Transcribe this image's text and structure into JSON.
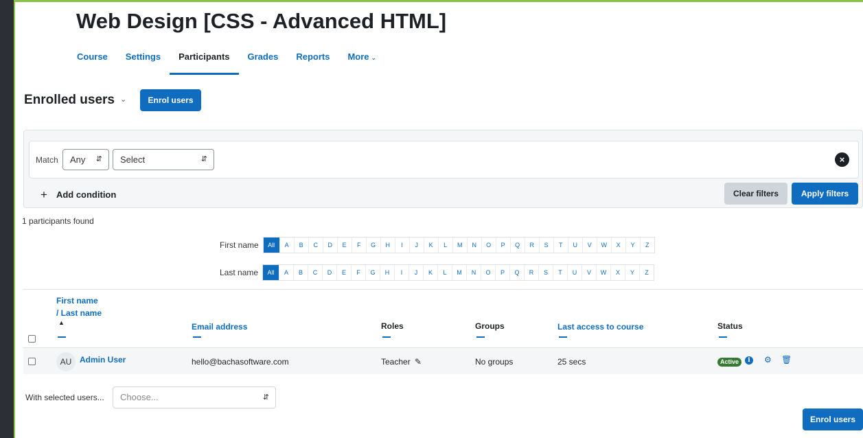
{
  "course": {
    "title": "Web Design [CSS - Advanced HTML]"
  },
  "nav": {
    "items": [
      {
        "label": "Course"
      },
      {
        "label": "Settings"
      },
      {
        "label": "Participants"
      },
      {
        "label": "Grades"
      },
      {
        "label": "Reports"
      },
      {
        "label": "More"
      }
    ],
    "active": "Participants"
  },
  "enrolled": {
    "heading": "Enrolled users",
    "enrol_button": "Enrol users"
  },
  "filters": {
    "match_label": "Match",
    "match_value": "Any",
    "field_value": "Select",
    "add_condition": "Add condition",
    "clear_button": "Clear filters",
    "apply_button": "Apply filters"
  },
  "results": {
    "found_text": "1 participants found"
  },
  "initials": {
    "first_label": "First name",
    "last_label": "Last name",
    "all_label": "All",
    "letters": [
      "A",
      "B",
      "C",
      "D",
      "E",
      "F",
      "G",
      "H",
      "I",
      "J",
      "K",
      "L",
      "M",
      "N",
      "O",
      "P",
      "Q",
      "R",
      "S",
      "T",
      "U",
      "V",
      "W",
      "X",
      "Y",
      "Z"
    ]
  },
  "table": {
    "headers": {
      "first_name": "First name",
      "last_name": "/ Last name",
      "sort_indicator": "▲",
      "email": "Email address",
      "roles": "Roles",
      "groups": "Groups",
      "last_access": "Last access to course",
      "status": "Status"
    },
    "rows": [
      {
        "initials": "AU",
        "name": "Admin User",
        "email": "hello@bachasoftware.com",
        "role": "Teacher",
        "groups": "No groups",
        "last_access": "25 secs",
        "status": "Active"
      }
    ]
  },
  "bulk": {
    "label": "With selected users...",
    "placeholder": "Choose...",
    "enrol_button": "Enrol users"
  },
  "colors": {
    "primary": "#0f6cbf",
    "active_badge": "#357a32",
    "accent_border": "#8bc34a"
  }
}
